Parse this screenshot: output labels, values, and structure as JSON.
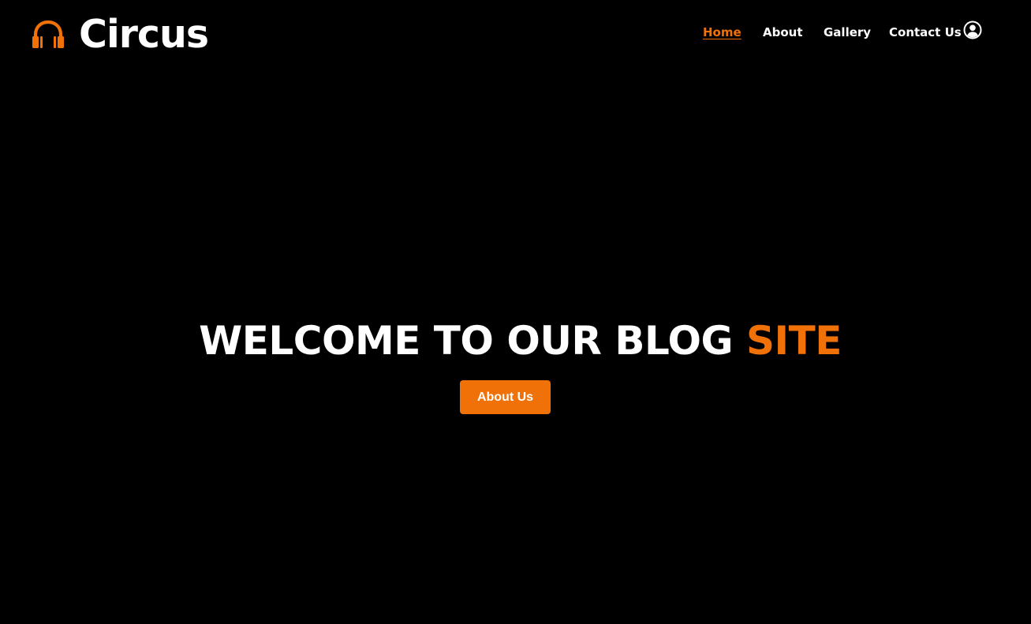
{
  "brand": {
    "name": "Circus",
    "icon": "headphones-icon",
    "accent_color": "#f07108"
  },
  "nav": {
    "items": [
      {
        "label": "Home",
        "active": true
      },
      {
        "label": "About",
        "active": false
      },
      {
        "label": "Gallery",
        "active": false
      },
      {
        "label": "Contact Us",
        "active": false
      }
    ],
    "account_icon": "user-circle-icon"
  },
  "hero": {
    "title_main": "WELCOME TO OUR BLOG ",
    "title_accent": "SITE",
    "button_label": "About Us"
  },
  "colors": {
    "background": "#000000",
    "text": "#ffffff",
    "accent": "#f07108"
  }
}
